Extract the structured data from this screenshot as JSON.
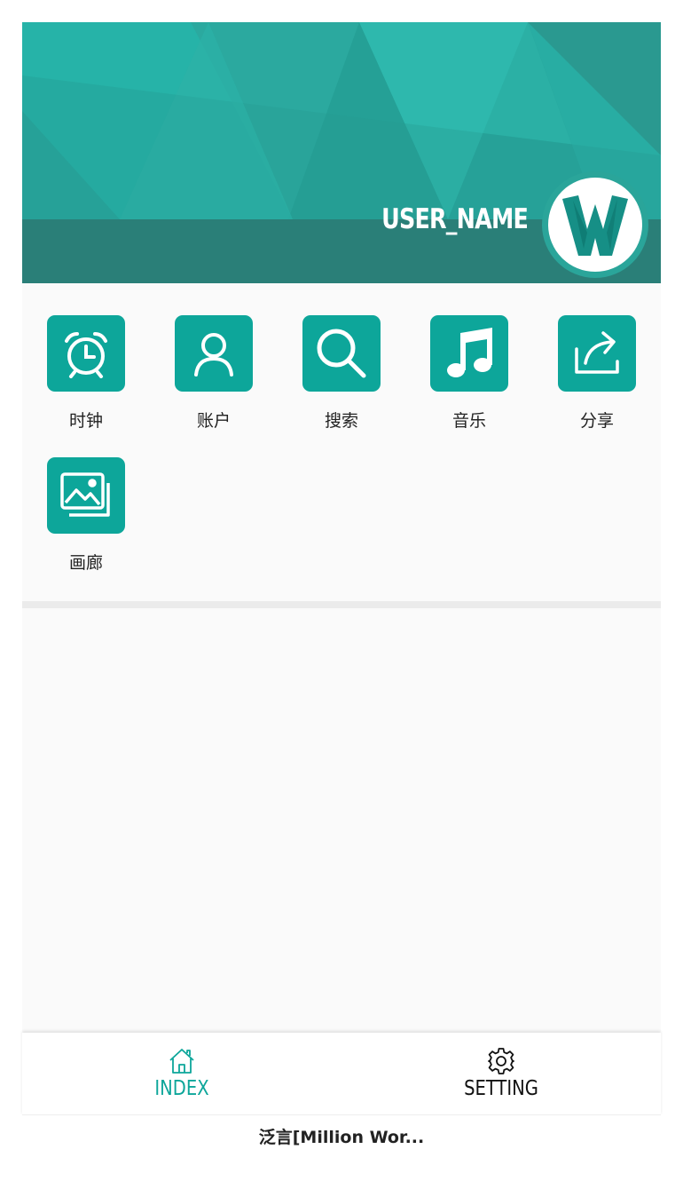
{
  "header": {
    "username": "USER_NAME",
    "avatar_icon": "w-logo-icon",
    "colors": {
      "dark": "#2a7f78",
      "light": "#2bb5aa",
      "accent": "#0da69a"
    }
  },
  "grid": {
    "items": [
      {
        "label": "时钟",
        "icon": "alarm-clock-icon"
      },
      {
        "label": "账户",
        "icon": "user-icon"
      },
      {
        "label": "搜索",
        "icon": "search-icon"
      },
      {
        "label": "音乐",
        "icon": "music-note-icon"
      },
      {
        "label": "分享",
        "icon": "share-icon"
      },
      {
        "label": "画廊",
        "icon": "gallery-icon"
      }
    ]
  },
  "tabs": [
    {
      "label": "INDEX",
      "icon": "home-icon",
      "active": true
    },
    {
      "label": "SETTING",
      "icon": "gear-icon",
      "active": false
    }
  ],
  "colors": {
    "active_tab": "#0da69a",
    "inactive_tab": "#111111"
  },
  "footer": {
    "title": "泛言[Million Wor..."
  }
}
